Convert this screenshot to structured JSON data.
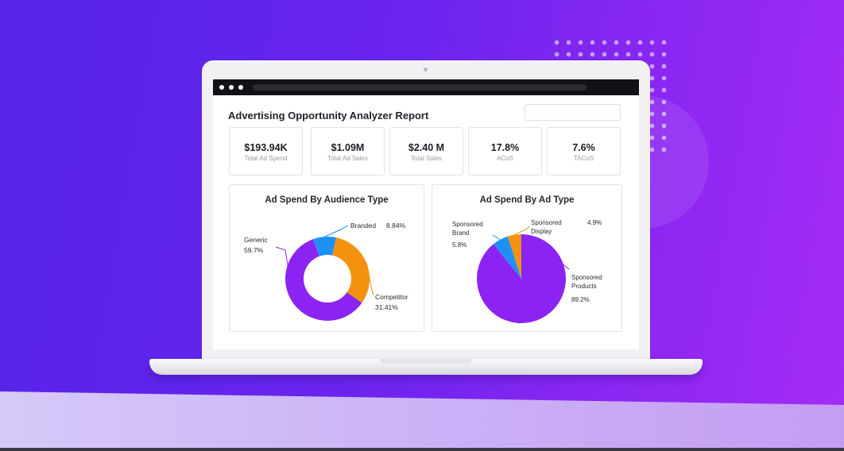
{
  "report": {
    "title": "Advertising Opportunity Analyzer Report"
  },
  "kpis": [
    {
      "value": "$193.94K",
      "label": "Total Ad Spend"
    },
    {
      "value": "$1.09M",
      "label": "Total Ad Sales"
    },
    {
      "value": "$2.40 M",
      "label": "Total Sales"
    },
    {
      "value": "17.8%",
      "label": "ACoS"
    },
    {
      "value": "7.6%",
      "label": "TACoS"
    }
  ],
  "chart_data": [
    {
      "type": "pie",
      "variant": "donut",
      "title": "Ad Spend By Audience Type",
      "slices": [
        {
          "label": "Generic",
          "value": 59.7,
          "display": "59.7%",
          "color": "#8b24f2"
        },
        {
          "label": "Branded",
          "value": 8.84,
          "display": "8.84%",
          "color": "#1e90f5"
        },
        {
          "label": "Competitor",
          "value": 31.41,
          "display": "31.41%",
          "color": "#f4920f"
        }
      ]
    },
    {
      "type": "pie",
      "title": "Ad Spend By Ad Type",
      "slices": [
        {
          "label": "Sponsored Products",
          "value": 89.2,
          "display": "89.2%",
          "color": "#8b24f2"
        },
        {
          "label": "Sponsored Brand",
          "value": 5.8,
          "display": "5.8%",
          "color": "#1e90f5"
        },
        {
          "label": "Sponsored Display",
          "value": 4.9,
          "display": "4.9%",
          "color": "#f4920f"
        }
      ]
    }
  ],
  "colors": {
    "background_start": "#5424e8",
    "background_end": "#a52cf5",
    "generic_purple": "#8b24f2",
    "branded_blue": "#1e90f5",
    "competitor_orange": "#f4920f"
  }
}
